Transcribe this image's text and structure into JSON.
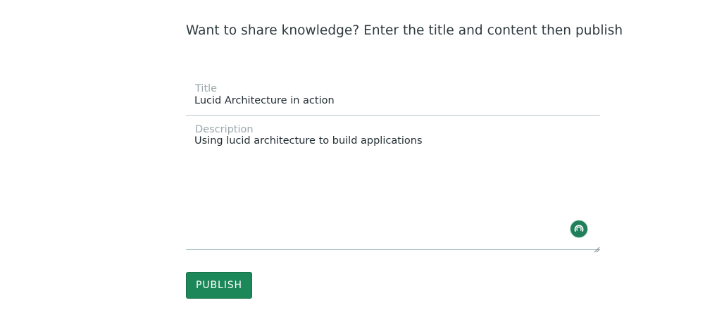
{
  "form": {
    "heading": "Want to share knowledge? Enter the title and content then publish",
    "title_field": {
      "label": "Title",
      "value": "Lucid Architecture in action"
    },
    "description_field": {
      "label": "Description",
      "value": "Using lucid architecture to build applications"
    },
    "publish_label": "PUBLISH"
  },
  "colors": {
    "accent": "#1c8758",
    "text": "#2f3a3f",
    "label": "#9aa7ab",
    "underline": "#b9c8cd"
  },
  "icons": {
    "assistant": "grammar-assistant-icon",
    "resize": "resize-handle-icon"
  }
}
